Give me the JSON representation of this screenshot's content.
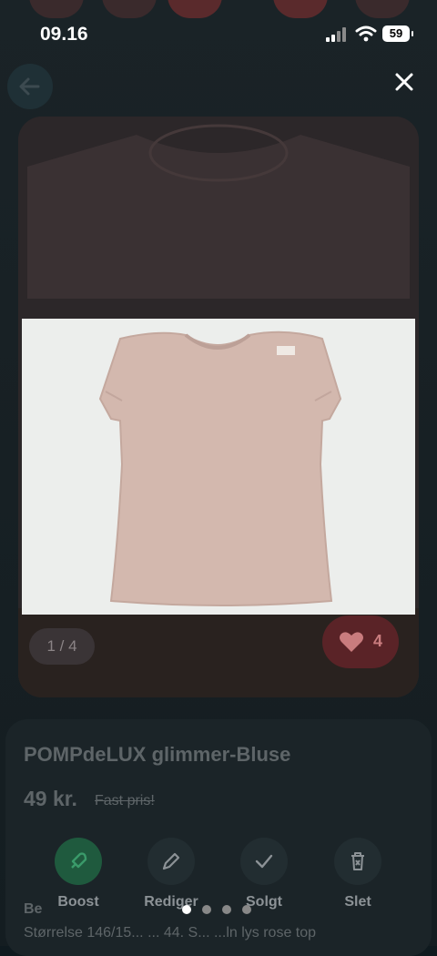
{
  "status": {
    "time": "09.16",
    "battery": "59"
  },
  "gallery": {
    "counter": "1 / 4",
    "likes": "4"
  },
  "listing": {
    "title": "POMPdeLUX glimmer-Bluse",
    "price": "49 kr.",
    "price_type": "Fast pris!",
    "desc_label": "Be",
    "desc_text": "Størrelse 146/15... ... 44. S... ...ln lys rose top"
  },
  "actions": [
    {
      "label": "Boost",
      "icon": "rocket-icon"
    },
    {
      "label": "Rediger",
      "icon": "pencil-icon"
    },
    {
      "label": "Solgt",
      "icon": "check-icon"
    },
    {
      "label": "Slet",
      "icon": "trash-icon"
    }
  ],
  "colors": {
    "boost_green": "#1f5a3e",
    "like_red": "#5a2327",
    "shirt_pink": "#d3b8ae"
  }
}
